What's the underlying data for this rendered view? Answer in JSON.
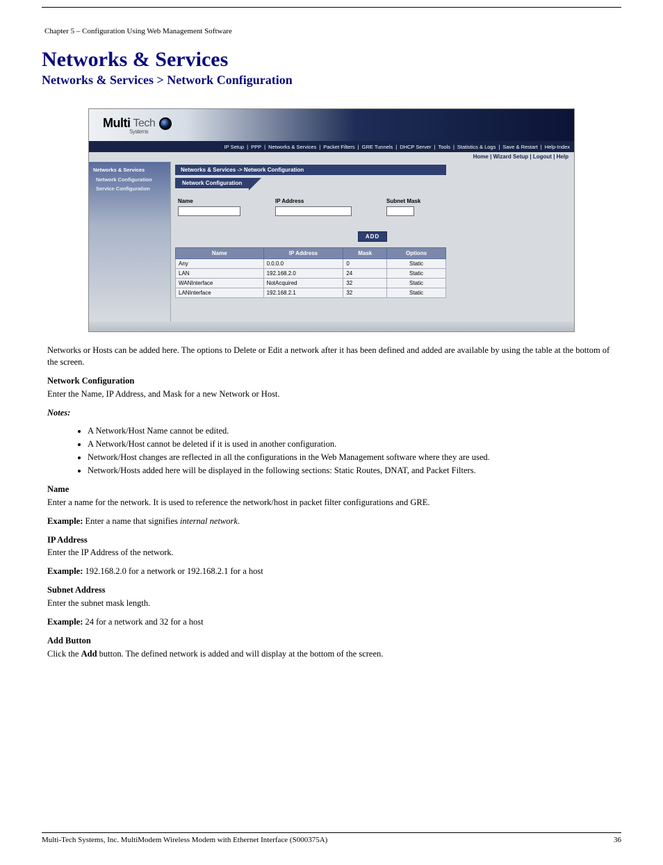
{
  "header": {
    "left": "Chapter 5 – Configuration Using Web Management Software",
    "right": ""
  },
  "title": "Networks & Services",
  "breadcrumb": "Networks & Services > Network Configuration",
  "app": {
    "logo": {
      "brand": "Multi",
      "tech": "Tech",
      "systems": "Systems"
    },
    "topnav": [
      "IP Setup",
      "PPP",
      "Networks & Services",
      "Packet Filters",
      "GRE Tunnels",
      "DHCP Server",
      "Tools",
      "Statistics & Logs",
      "Save & Restart",
      "Help-Index"
    ],
    "subnav": [
      "Home",
      "Wizard Setup",
      "Logout",
      "Help"
    ],
    "sidebar": {
      "title": "Networks & Services",
      "items": [
        "Network Configuration",
        "Service Configuration"
      ]
    },
    "crumb_dark": "Networks & Services  ->  Network Configuration",
    "crumb_tab": "Network Configuration",
    "form": {
      "name_label": "Name",
      "ip_label": "IP Address",
      "mask_label": "Subnet Mask",
      "add_label": "ADD"
    },
    "table": {
      "headers": [
        "Name",
        "IP Address",
        "Mask",
        "Options"
      ],
      "rows": [
        {
          "name": "Any",
          "ip": "0.0.0.0",
          "mask": "0",
          "options": "Static"
        },
        {
          "name": "LAN",
          "ip": "192.168.2.0",
          "mask": "24",
          "options": "Static"
        },
        {
          "name": "WANInterface",
          "ip": "NotAcquired",
          "mask": "32",
          "options": "Static"
        },
        {
          "name": "LANInterface",
          "ip": "192.168.2.1",
          "mask": "32",
          "options": "Static"
        }
      ]
    }
  },
  "body": {
    "p1": "Networks or Hosts can be added here. The options to Delete or Edit a network after it has been defined and added are available by using the table at the bottom of the screen.",
    "net_conf_head": "Network Configuration",
    "net_conf_text": "Enter the Name, IP Address, and Mask for a new Network or Host.",
    "notes_head": "Notes:",
    "notes": [
      "A Network/Host Name cannot be edited.",
      "A Network/Host cannot be deleted if it is used in another configuration.",
      "Network/Host changes are reflected in all the configurations in the Web Management software where they are used.",
      "Network/Hosts added here will be displayed in the following sections: Static Routes, DNAT, and Packet Filters."
    ],
    "name_head": "Name",
    "name_text_1": "Enter a name for the network. It is used to reference the network/host in packet filter configurations and GRE.",
    "name_text_2_label": "Example:",
    "name_text_2": " Enter a name that signifies ",
    "name_text_2_em": "internal network",
    "name_text_2_tail": ".",
    "ip_head": "IP Address",
    "ip_text_1": "Enter the IP Address of the network.",
    "ip_text_2_label": "Example:",
    "ip_text_2": " 192.168.2.0 for a network or 192.168.2.1 for a host",
    "mask_head": "Subnet Address",
    "mask_text_1": "Enter the subnet mask length.",
    "mask_text_2_label": "Example:",
    "mask_text_2": " 24 for a network and 32 for a host",
    "add_head": "Add Button",
    "add_text_1": "Click the ",
    "add_text_b": "Add",
    "add_text_2": " button. The defined network is added and will display at the bottom of the screen."
  },
  "footer": {
    "left": "Multi-Tech Systems, Inc. MultiModem Wireless Modem with Ethernet Interface (S000375A)",
    "right": "36"
  }
}
